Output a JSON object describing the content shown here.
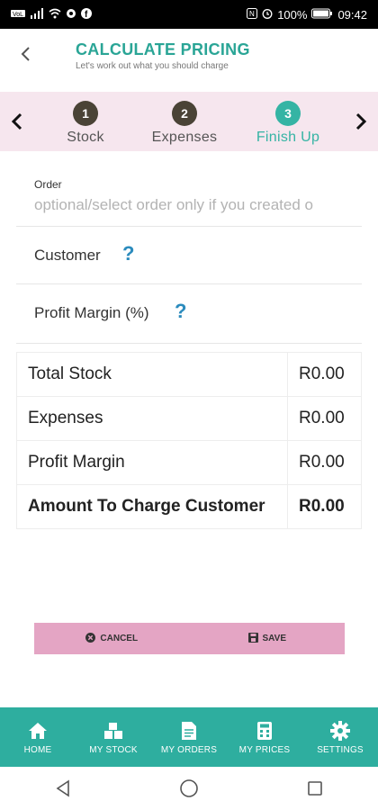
{
  "status_bar": {
    "left_icons": [
      "volte-icon",
      "signal-icon",
      "wifi-icon",
      "sync-icon",
      "facebook-icon"
    ],
    "right_text": "100%",
    "time": "09:42"
  },
  "header": {
    "title": "CALCULATE PRICING",
    "subtitle": "Let's work out what you should charge"
  },
  "stepper": {
    "steps": [
      {
        "number": "1",
        "label": "Stock"
      },
      {
        "number": "2",
        "label": "Expenses"
      },
      {
        "number": "3",
        "label": "Finish Up"
      }
    ],
    "active_step": 3
  },
  "form": {
    "order_label": "Order",
    "order_placeholder": "optional/select order only if you created o",
    "customer_label": "Customer",
    "profit_margin_label": "Profit Margin (%)",
    "help_symbol": "?"
  },
  "summary": {
    "rows": [
      {
        "label": "Total Stock",
        "value": "R0.00"
      },
      {
        "label": "Expenses",
        "value": "R0.00"
      },
      {
        "label": "Profit Margin",
        "value": "R0.00"
      },
      {
        "label": "Amount To Charge Customer",
        "value": "R0.00"
      }
    ]
  },
  "actions": {
    "cancel_label": "CANCEL",
    "save_label": "SAVE"
  },
  "bottom_nav": {
    "items": [
      {
        "label": "HOME",
        "icon": "home-icon"
      },
      {
        "label": "MY STOCK",
        "icon": "boxes-icon"
      },
      {
        "label": "MY ORDERS",
        "icon": "document-icon"
      },
      {
        "label": "MY PRICES",
        "icon": "calculator-icon"
      },
      {
        "label": "SETTINGS",
        "icon": "gear-icon"
      }
    ]
  },
  "colors": {
    "accent": "#2aa596",
    "stepper_bg": "#f6e6ee",
    "action_bar": "#e4a5c4",
    "nav_bg": "#2eae9f",
    "help_icon": "#2b8bbd"
  }
}
